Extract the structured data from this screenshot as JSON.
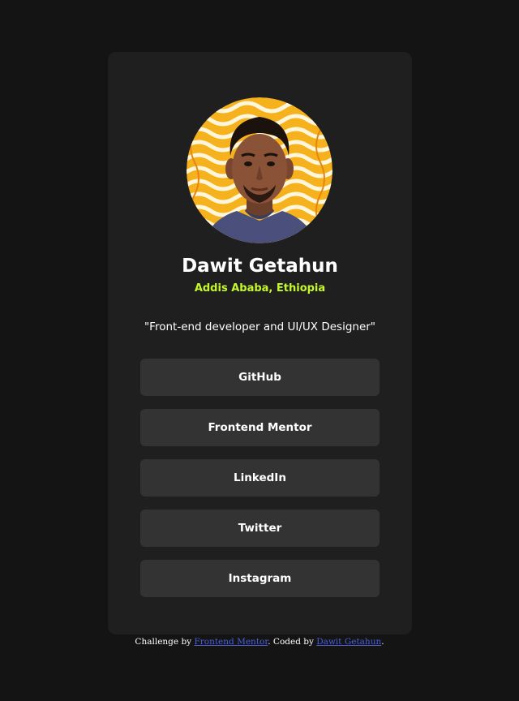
{
  "profile": {
    "name": "Dawit Getahun",
    "location": "Addis Ababa, Ethiopia",
    "bio": "\"Front-end developer and UI/UX Designer\""
  },
  "links": [
    {
      "label": "GitHub"
    },
    {
      "label": "Frontend Mentor"
    },
    {
      "label": "LinkedIn"
    },
    {
      "label": "Twitter"
    },
    {
      "label": "Instagram"
    }
  ],
  "attribution": {
    "prefix": "Challenge by",
    "challenge_link": "Frontend Mentor",
    "middle": ". Coded by",
    "author_link": "Dawit Getahun",
    "suffix": "."
  },
  "colors": {
    "page_background": "#141414",
    "card_background": "#1f1f1f",
    "button_background": "#333333",
    "accent_green": "#c4f82a",
    "link_blue": "#4a5fd9"
  }
}
